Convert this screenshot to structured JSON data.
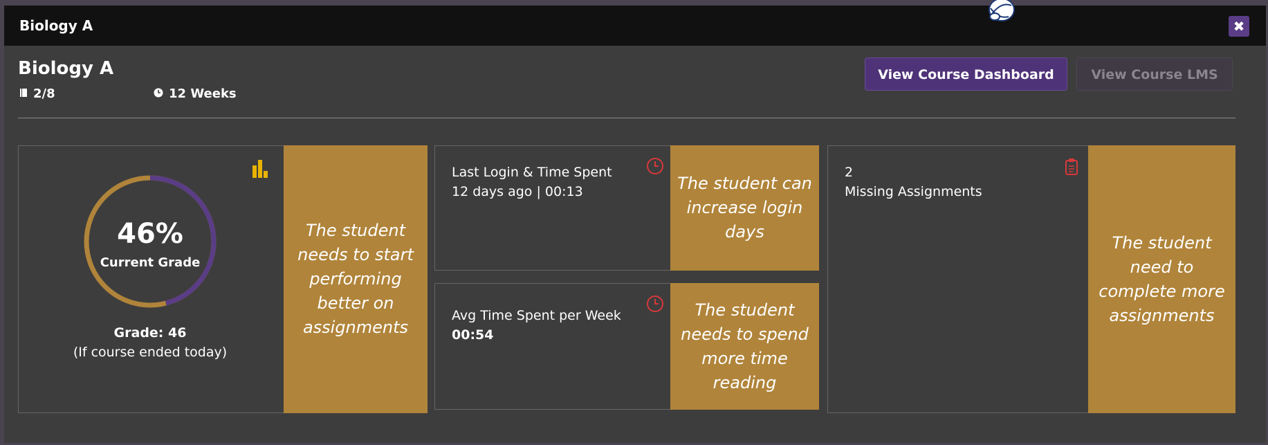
{
  "window": {
    "title": "Biology A"
  },
  "header": {
    "course_title": "Biology A",
    "progress": "2/8",
    "duration": "12 Weeks",
    "view_dashboard_label": "View Course Dashboard",
    "view_lms_label": "View Course LMS"
  },
  "grade_card": {
    "percent_label": "46%",
    "percent_value": 46,
    "caption": "Current Grade",
    "grade_line": "Grade: 46",
    "grade_note": "(If course ended today)",
    "message": "The student needs to start performing better on assignments"
  },
  "login_card": {
    "label": "Last Login & Time Spent",
    "value": "12 days ago | 00:13",
    "message": "The student can increase login days"
  },
  "time_card": {
    "label": "Avg Time Spent per Week",
    "value": "00:54",
    "message": "The student needs to spend more time reading"
  },
  "assignments_card": {
    "count": "2",
    "label": "Missing Assignments",
    "message": "The student need to complete more assignments"
  },
  "icons": {
    "close": "close-icon",
    "book": "book-icon",
    "clock": "clock-icon",
    "chart": "bar-chart-icon",
    "clipboard": "clipboard-icon",
    "globe": "globe-icon"
  },
  "colors": {
    "accent_purple": "#4f3378",
    "note_gold": "#b0843a",
    "ring_gold": "#b0843a",
    "ring_purple": "#5a3d86",
    "alert_red": "#d9383a",
    "chart_yellow": "#e8b400"
  }
}
